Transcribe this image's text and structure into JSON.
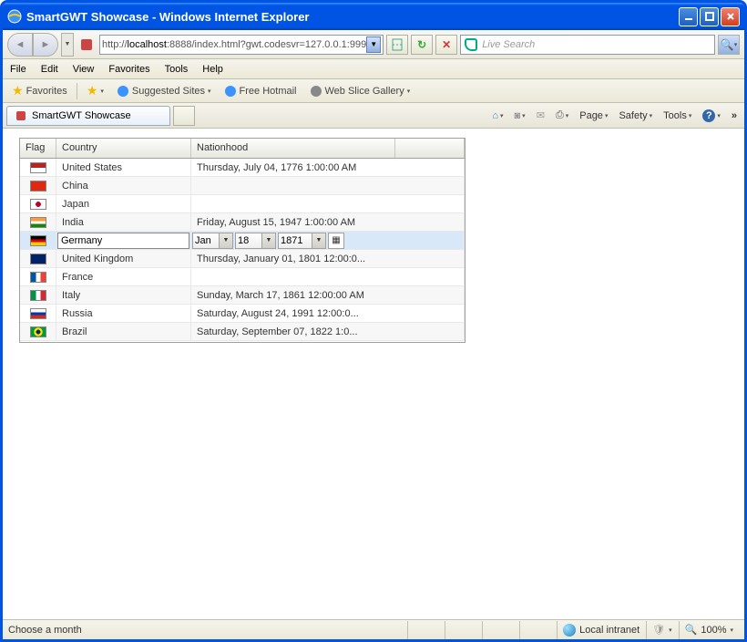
{
  "window": {
    "title": "SmartGWT Showcase - Windows Internet Explorer"
  },
  "address": {
    "prefix": "http://",
    "host": "localhost",
    "suffix": ":8888/index.html?gwt.codesvr=127.0.0.1:999"
  },
  "search": {
    "placeholder": "Live Search"
  },
  "menus": [
    "File",
    "Edit",
    "View",
    "Favorites",
    "Tools",
    "Help"
  ],
  "favbar": {
    "favorites": "Favorites",
    "suggested": "Suggested Sites",
    "hotmail": "Free Hotmail",
    "webslice": "Web Slice Gallery"
  },
  "tab": {
    "title": "SmartGWT Showcase"
  },
  "pageTools": [
    "Page",
    "Safety",
    "Tools"
  ],
  "grid": {
    "headers": {
      "flag": "Flag",
      "country": "Country",
      "nation": "Nationhood"
    },
    "rows": [
      {
        "country": "United States",
        "nation": "Thursday, July 04, 1776 1:00:00 AM",
        "flag": "us"
      },
      {
        "country": "China",
        "nation": "",
        "flag": "cn"
      },
      {
        "country": "Japan",
        "nation": "",
        "flag": "jp"
      },
      {
        "country": "India",
        "nation": "Friday, August 15, 1947 1:00:00 AM",
        "flag": "in"
      },
      {
        "country": "Germany",
        "nation": "",
        "flag": "de",
        "editing": true
      },
      {
        "country": "United Kingdom",
        "nation": "Thursday, January 01, 1801 12:00:0...",
        "flag": "uk"
      },
      {
        "country": "France",
        "nation": "",
        "flag": "fr"
      },
      {
        "country": "Italy",
        "nation": "Sunday, March 17, 1861 12:00:00 AM",
        "flag": "it"
      },
      {
        "country": "Russia",
        "nation": "Saturday, August 24, 1991 12:00:0...",
        "flag": "ru"
      },
      {
        "country": "Brazil",
        "nation": "Saturday, September 07, 1822 1:0...",
        "flag": "br"
      }
    ],
    "editor": {
      "month": "Jan",
      "day": "18",
      "year": "1871"
    }
  },
  "status": {
    "text": "Choose a month",
    "zone": "Local intranet",
    "zoom": "100%"
  },
  "flagColors": {
    "us": "background: linear-gradient(to bottom, #b22 0, #b22 50%, #fff 50%, #fff 100%); position:relative;",
    "cn": "background: #de2910;",
    "jp": "background: radial-gradient(circle at center, #bc002d 0, #bc002d 30%, #fff 31%);",
    "in": "background: linear-gradient(to bottom, #f93 33%, #fff 33%, #fff 66%, #138808 66%);",
    "de": "background: linear-gradient(to bottom, #000 33%, #d00 33%, #d00 66%, #fc0 66%);",
    "uk": "background: #012169;",
    "fr": "background: linear-gradient(to right, #0055a4 33%, #fff 33%, #fff 66%, #ef4135 66%);",
    "it": "background: linear-gradient(to right, #009246 33%, #fff 33%, #fff 66%, #ce2b37 66%);",
    "ru": "background: linear-gradient(to bottom, #fff 33%, #0039a6 33%, #0039a6 66%, #d52b1e 66%);",
    "br": "background: radial-gradient(circle at center, #002776 0, #002776 25%, #fedf00 26%, #fedf00 50%, #009b3a 51%);"
  }
}
